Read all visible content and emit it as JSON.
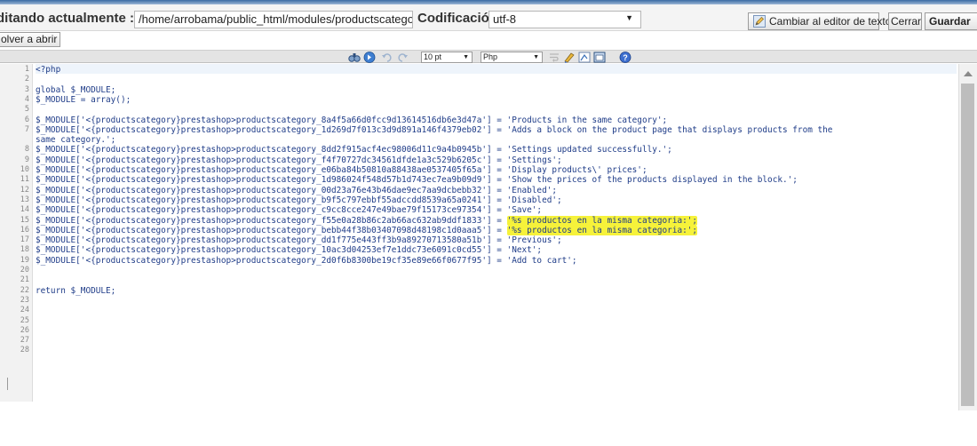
{
  "header": {
    "editing_label": "ditando actualmente :",
    "path_value": "/home/arrobama/public_html/modules/productscategory/",
    "encoding_label": "Codificación:",
    "encoding_value": "utf-8",
    "switch_editor_label": "Cambiar al editor de texto",
    "close_label": "Cerrar",
    "save_label": "Guardar"
  },
  "row2": {
    "reopen_label": "olver a abrir"
  },
  "toolbar": {
    "font_size_value": "10 pt",
    "language_value": "Php",
    "icons": [
      "find-icon",
      "goto-icon",
      "undo-icon",
      "redo-icon",
      "wordwrap-icon",
      "highlight-icon",
      "reset-icon",
      "fullscreen-icon",
      "help-icon"
    ]
  },
  "code": {
    "line_numbers": [
      "1",
      "2",
      "3",
      "4",
      "5",
      "6",
      "7",
      "8",
      "9",
      "10",
      "11",
      "12",
      "13",
      "14",
      "15",
      "16",
      "17",
      "18",
      "19",
      "20",
      "21",
      "22",
      "23",
      "24",
      "25",
      "26",
      "27",
      "28"
    ],
    "lines": [
      "<?php",
      "",
      "global $_MODULE;",
      "$_MODULE = array();",
      "",
      "$_MODULE['<{productscategory}prestashop>productscategory_8a4f5a66d0fcc9d13614516db6e3d47a'] = 'Products in the same category';",
      "$_MODULE['<{productscategory}prestashop>productscategory_1d269d7f013c3d9d891a146f4379eb02'] = 'Adds a block on the product page that displays products from the",
      "same category.';",
      "$_MODULE['<{productscategory}prestashop>productscategory_8dd2f915acf4ec98006d11c9a4b0945b'] = 'Settings updated successfully.';",
      "$_MODULE['<{productscategory}prestashop>productscategory_f4f70727dc34561dfde1a3c529b6205c'] = 'Settings';",
      "$_MODULE['<{productscategory}prestashop>productscategory_e06ba84b50810a88438ae0537405f65a'] = 'Display products\\' prices';",
      "$_MODULE['<{productscategory}prestashop>productscategory_1d986024f548d57b1d743ec7ea9b09d9'] = 'Show the prices of the products displayed in the block.';",
      "$_MODULE['<{productscategory}prestashop>productscategory_00d23a76e43b46dae9ec7aa9dcbebb32'] = 'Enabled';",
      "$_MODULE['<{productscategory}prestashop>productscategory_b9f5c797ebbf55adccdd8539a65a0241'] = 'Disabled';",
      "$_MODULE['<{productscategory}prestashop>productscategory_c9cc8cce247e49bae79f15173ce97354'] = 'Save';",
      "$_MODULE['<{productscategory}prestashop>productscategory_f55e0a28b86c2ab66ac632ab9ddf1833'] = '%s productos en la misma categoria:';",
      "$_MODULE['<{productscategory}prestashop>productscategory_bebb44f38b03407098d48198c1d0aaa5'] = '%s productos en la misma categoria:';",
      "$_MODULE['<{productscategory}prestashop>productscategory_dd1f775e443ff3b9a89270713580a51b'] = 'Previous';",
      "$_MODULE['<{productscategory}prestashop>productscategory_10ac3d04253ef7e1ddc73e6091c0cd55'] = 'Next';",
      "$_MODULE['<{productscategory}prestashop>productscategory_2d0f6b8300be19cf35e89e66f0677f95'] = 'Add to cart';",
      "",
      "",
      "return $_MODULE;",
      "",
      "",
      "",
      "",
      "",
      ""
    ],
    "highlighted_line_indices": [
      15,
      16
    ]
  }
}
